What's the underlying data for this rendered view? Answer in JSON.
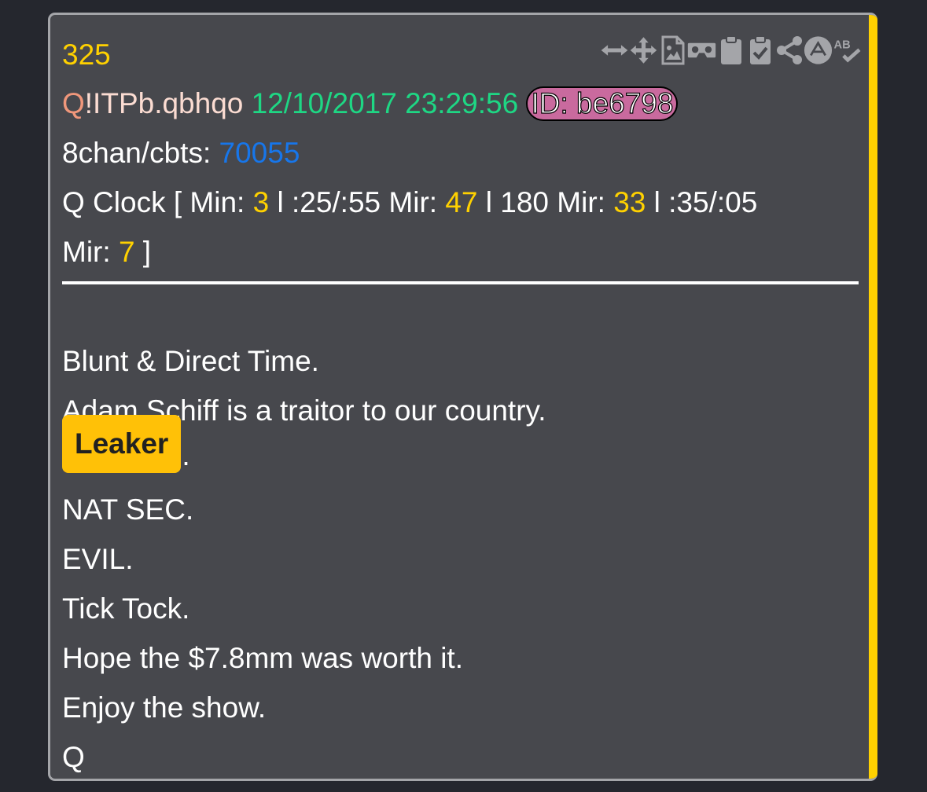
{
  "post": {
    "number": "325",
    "author_q": "Q",
    "author_trip": "!ITPb.qbhqo",
    "timestamp": "12/10/2017 23:29:56",
    "id_badge": "ID: be6798",
    "board_label": "8chan/cbts: ",
    "board_ref": "70055",
    "clock": {
      "prefix": "Q Clock [ Min: ",
      "min": "3",
      "sep1": " l :25/:55 Mir: ",
      "mir1": "47",
      "sep2": " l 180 Mir: ",
      "mir2": "33",
      "sep3": " l :35/:05",
      "line2_prefix": "Mir: ",
      "mir3": "7",
      "line2_suffix": " ]"
    },
    "body": {
      "line1": "Blunt & Direct Time.",
      "line2": "Adam Schiff is a traitor to our country.",
      "leaker": "Leaker",
      "leaker_period": ".",
      "line4": "NAT SEC.",
      "line5": "EVIL.",
      "line6": "Tick Tock.",
      "line7": "Hope the $7.8mm was worth it.",
      "line8": "Enjoy the show.",
      "line9": "Q"
    }
  },
  "toolbar": {
    "icons": [
      "arrows-horizontal-icon",
      "move-icon",
      "image-file-icon",
      "vr-goggles-icon",
      "clipboard-icon",
      "clipboard-check-icon",
      "share-icon",
      "up-arrow-circle-icon",
      "spellcheck-icon"
    ],
    "icon_color": "#a4a5a9"
  },
  "colors": {
    "background": "#25272e",
    "card": "#47484d",
    "accent": "#ffd100",
    "timestamp": "#1ed784",
    "link": "#1776ea",
    "id_badge": "#c96a9e",
    "leaker_badge": "#ffc107"
  }
}
